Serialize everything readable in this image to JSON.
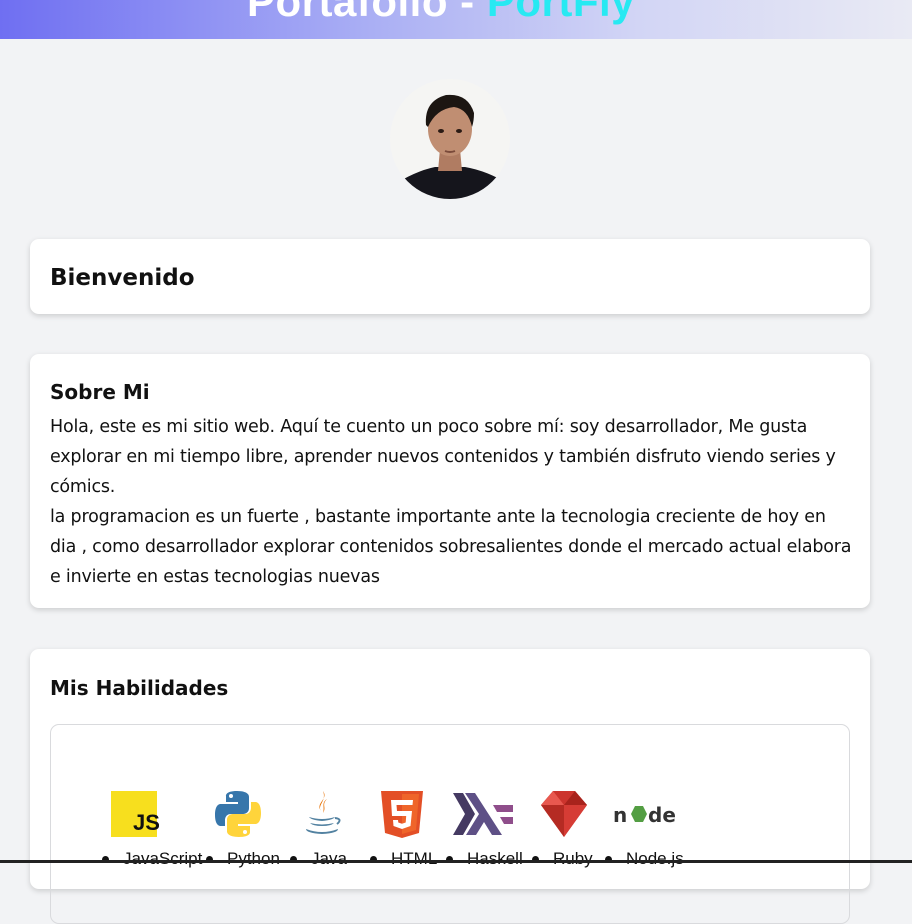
{
  "header": {
    "title_main": "Portafolio - ",
    "title_accent": "PortFly"
  },
  "avatar": {
    "icon": "profile-photo"
  },
  "welcome": {
    "heading": "Bienvenido"
  },
  "about": {
    "heading": "Sobre Mi",
    "paragraph1": "Hola, este es mi sitio web. Aquí te cuento un poco sobre mí: soy desarrollador, Me gusta explorar en mi tiempo libre, aprender nuevos contenidos y también disfruto viendo series y cómics.",
    "paragraph2": "la programacion es un fuerte , bastante importante ante la tecnologia creciente de hoy en dia , como desarrollador explorar contenidos sobresalientes donde el mercado actual elabora e invierte en estas tecnologias nuevas"
  },
  "skills": {
    "heading": "Mis Habilidades",
    "items": [
      {
        "label": "JavaScript",
        "icon": "javascript-logo"
      },
      {
        "label": "Python",
        "icon": "python-logo"
      },
      {
        "label": "Java",
        "icon": "java-logo"
      },
      {
        "label": "HTML",
        "icon": "html5-logo"
      },
      {
        "label": "Haskell",
        "icon": "haskell-logo"
      },
      {
        "label": "Ruby",
        "icon": "ruby-logo"
      },
      {
        "label": "Node.js",
        "icon": "nodejs-logo"
      }
    ]
  },
  "colors": {
    "header_start": "#6f6ff2",
    "header_end": "#e9eaf4",
    "title_accent": "#27e9f2",
    "page_bg": "#f2f3f5"
  }
}
